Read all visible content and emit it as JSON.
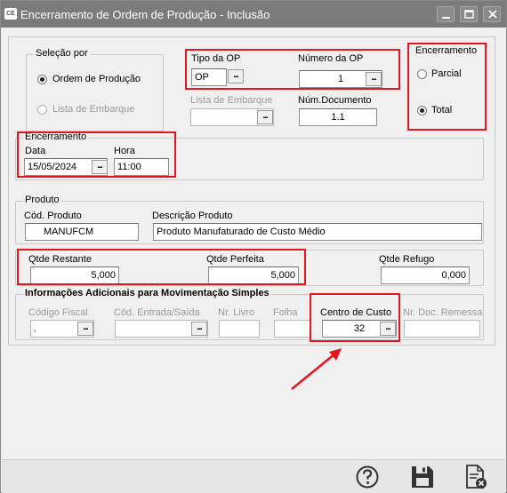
{
  "window": {
    "app_icon_text": "CE",
    "title": "Encerramento de Ordem de Produção - Inclusão"
  },
  "selecao": {
    "title": "Seleção por",
    "option_ordem": "Ordem de Produção",
    "option_lista": "Lista de Embarque",
    "selected": "Ordem de Produção"
  },
  "op": {
    "tipo_label": "Tipo da OP",
    "tipo_value": "OP",
    "numero_label": "Número da OP",
    "numero_value": "1",
    "lista_label": "Lista de Embarque",
    "lista_value": "",
    "num_doc_label": "Núm.Documento",
    "num_doc_value": "1.1"
  },
  "encerramento_tipo": {
    "title": "Encerramento",
    "parcial": "Parcial",
    "total": "Total",
    "selected": "Total"
  },
  "encerramento": {
    "title": "Encerramento",
    "data_label": "Data",
    "data_value": "15/05/2024",
    "hora_label": "Hora",
    "hora_value": "11:00"
  },
  "produto": {
    "title": "Produto",
    "cod_label": "Cód. Produto",
    "cod_value": "MANUFCM",
    "desc_label": "Descrição Produto",
    "desc_value": "Produto Manufaturado de Custo Médio"
  },
  "quantidades": {
    "restante_label": "Qtde Restante",
    "restante_value": "5,000",
    "perfeita_label": "Qtde Perfeita",
    "perfeita_value": "5,000",
    "refugo_label": "Qtde Refugo",
    "refugo_value": "0,000"
  },
  "info_adicionais": {
    "title": "Informações Adicionais para Movimentação Simples",
    "codigo_fiscal_label": "Código Fiscal",
    "codigo_fiscal_value": ".",
    "cod_entrada_label": "Cód. Entrada/Saída",
    "cod_entrada_value": "",
    "nr_livro_label": "Nr. Livro",
    "nr_livro_value": "",
    "folha_label": "Folha",
    "folha_value": "",
    "centro_custo_label": "Centro de Custo",
    "centro_custo_value": "32",
    "nr_doc_remessa_label": "Nr. Doc. Remessa",
    "nr_doc_remessa_value": ""
  },
  "dots_label": "...",
  "icons": {
    "help": "help-icon",
    "save": "save-icon",
    "cancel": "cancel-document-icon",
    "minimize": "minimize-icon",
    "maximize": "maximize-icon",
    "close": "close-icon"
  },
  "colors": {
    "titlebar": "#7b7b7b",
    "highlight": "#e8141b",
    "window_bg": "#f0f0f0"
  }
}
